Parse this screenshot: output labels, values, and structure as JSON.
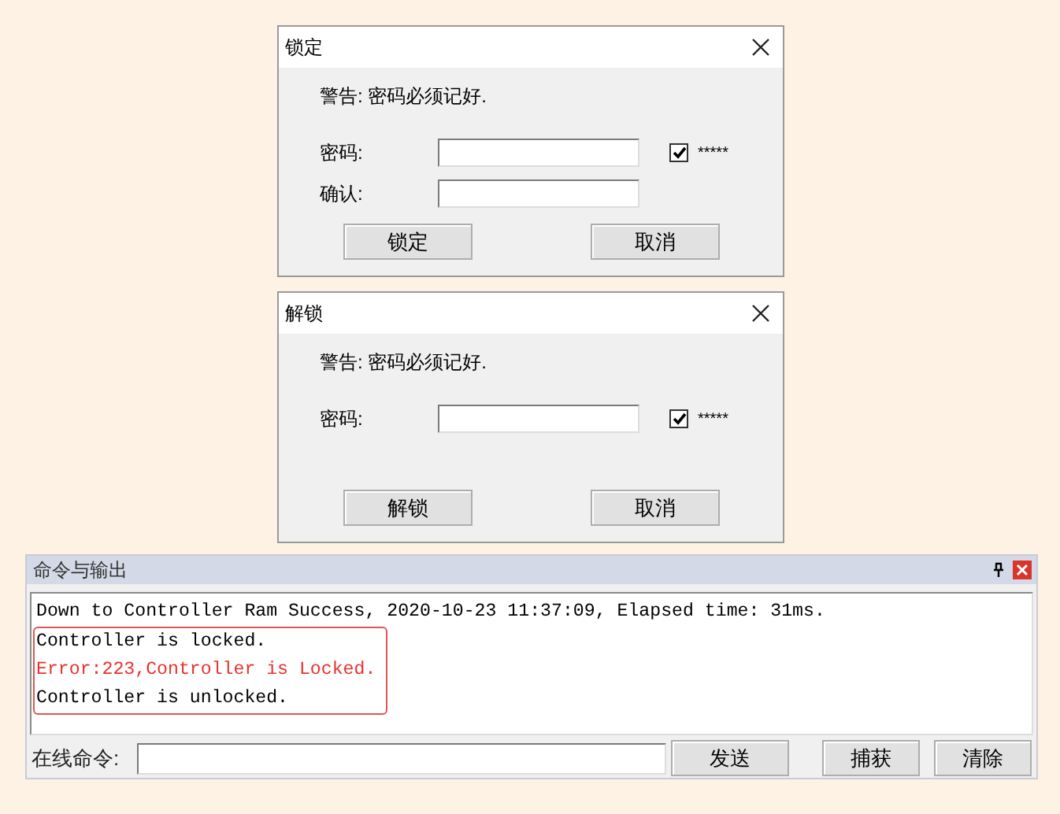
{
  "dialogs": [
    {
      "title": "锁定",
      "warning": "警告: 密码必须记好.",
      "fields": [
        {
          "label": "密码:",
          "checkbox": {
            "checked": true,
            "label": "*****"
          }
        },
        {
          "label": "确认:"
        }
      ],
      "buttons": [
        "锁定",
        "取消"
      ]
    },
    {
      "title": "解锁",
      "warning": "警告: 密码必须记好.",
      "fields": [
        {
          "label": "密码:",
          "checkbox": {
            "checked": true,
            "label": "*****"
          }
        }
      ],
      "buttons": [
        "解锁",
        "取消"
      ]
    }
  ],
  "output_panel": {
    "title": "命令与输出",
    "lines": [
      {
        "text": "Down to Controller Ram Success, 2020-10-23 11:37:09, Elapsed time: 31ms.",
        "kind": "normal"
      }
    ],
    "highlighted_block": {
      "lines": [
        {
          "text": "Controller is locked.",
          "kind": "normal"
        },
        {
          "text": "Error:223,Controller is Locked.",
          "kind": "error"
        },
        {
          "text": "Controller is unlocked.",
          "kind": "normal"
        }
      ]
    },
    "command_label": "在线命令:",
    "buttons": [
      "发送",
      "捕获",
      "清除"
    ]
  }
}
